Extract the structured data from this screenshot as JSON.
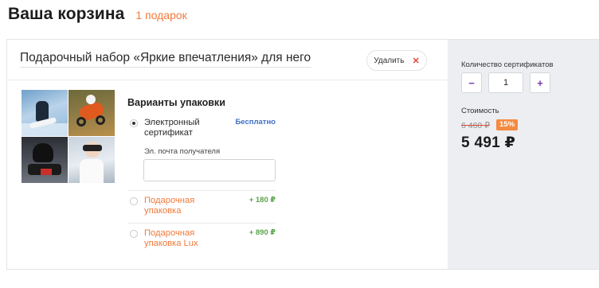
{
  "header": {
    "title": "Ваша корзина",
    "gift_count": "1 подарок"
  },
  "product": {
    "title": "Подарочный набор «Яркие впечатления» для него",
    "remove_label": "Удалить",
    "remove_icon": "close-icon",
    "photos": [
      "photo-surfing",
      "photo-motocross",
      "photo-karting",
      "photo-vr"
    ]
  },
  "packaging": {
    "heading": "Варианты упаковки",
    "options": [
      {
        "label": "Электронный сертификат",
        "price": "Бесплатно",
        "selected": true
      },
      {
        "label": "Подарочная упаковка",
        "price": "+ 180 ₽",
        "selected": false
      },
      {
        "label": "Подарочная упаковка Lux",
        "price": "+ 890 ₽",
        "selected": false
      }
    ],
    "email": {
      "label": "Эл. почта получателя",
      "value": "",
      "placeholder": ""
    }
  },
  "summary": {
    "quantity_label": "Количество сертификатов",
    "minus_label": "−",
    "plus_label": "+",
    "quantity": "1",
    "cost_label": "Стоимость",
    "old_price": "6 460 ₽",
    "discount": "15%",
    "price": "5 491 ₽"
  },
  "colors": {
    "accent_orange": "#f27a3a",
    "link_blue": "#3d6fc4",
    "price_green": "#5ca34c",
    "stepper_purple": "#7a3aa8",
    "sidebar_bg": "#eceef1"
  }
}
